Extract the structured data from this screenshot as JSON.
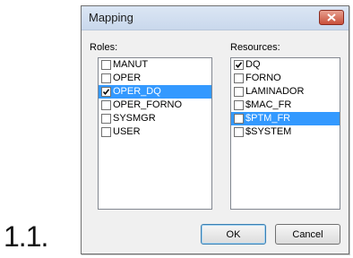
{
  "step_label": "1.1.",
  "dialog": {
    "title": "Mapping",
    "close_icon": "close-icon",
    "roles": {
      "label": "Roles:",
      "items": [
        {
          "label": "MANUT",
          "checked": false,
          "selected": false
        },
        {
          "label": "OPER",
          "checked": false,
          "selected": false
        },
        {
          "label": "OPER_DQ",
          "checked": true,
          "selected": true
        },
        {
          "label": "OPER_FORNO",
          "checked": false,
          "selected": false
        },
        {
          "label": "SYSMGR",
          "checked": false,
          "selected": false
        },
        {
          "label": "USER",
          "checked": false,
          "selected": false
        }
      ]
    },
    "resources": {
      "label": "Resources:",
      "items": [
        {
          "label": "DQ",
          "checked": true,
          "selected": false
        },
        {
          "label": "FORNO",
          "checked": false,
          "selected": false
        },
        {
          "label": "LAMINADOR",
          "checked": false,
          "selected": false
        },
        {
          "label": "$MAC_FR",
          "checked": false,
          "selected": false
        },
        {
          "label": "$PTM_FR",
          "checked": false,
          "selected": true
        },
        {
          "label": "$SYSTEM",
          "checked": false,
          "selected": false
        }
      ]
    },
    "ok_label": "OK",
    "cancel_label": "Cancel"
  },
  "colors": {
    "selection": "#3399ff",
    "close_button": "#c9503a"
  }
}
